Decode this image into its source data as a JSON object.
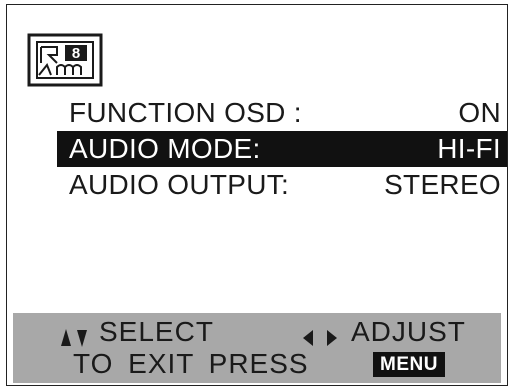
{
  "logo": {
    "icon": "osd-logo-icon",
    "badge_text": "8"
  },
  "menu": {
    "items": [
      {
        "label": "FUNCTION OSD :",
        "value": "ON",
        "selected": false
      },
      {
        "label": "AUDIO MODE:",
        "value": "HI-FI",
        "selected": true
      },
      {
        "label": "AUDIO OUTPUT:",
        "value": "STEREO",
        "selected": false
      }
    ]
  },
  "footer": {
    "select_label": "SELECT",
    "adjust_label": "ADJUST",
    "exit_label": "TO EXIT PRESS",
    "menu_button": "MENU",
    "up_down_icon": "up-down-arrows-icon",
    "left_right_icon": "left-right-arrows-icon"
  },
  "colors": {
    "background": "#ffffff",
    "text": "#1a1a1a",
    "highlight_bg": "#111111",
    "highlight_text": "#ffffff",
    "footer_bg": "#a8a8a8"
  }
}
